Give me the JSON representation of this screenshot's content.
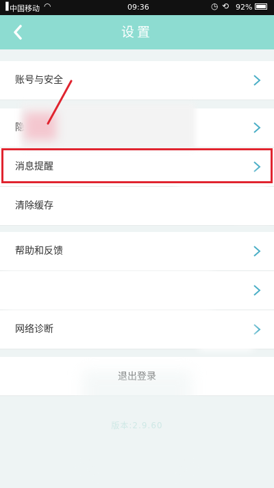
{
  "status_bar": {
    "carrier": "中国移动",
    "time": "09:36",
    "battery": "92%"
  },
  "nav": {
    "title": "设置",
    "back_icon": "chevron-left-icon"
  },
  "settings": {
    "items": [
      {
        "label": "账号与安全"
      },
      {
        "label": "隐"
      },
      {
        "label": "消息提醒"
      },
      {
        "label": "清除缓存"
      },
      {
        "label": "帮助和反馈"
      },
      {
        "label": ""
      },
      {
        "label": "网络诊断"
      }
    ]
  },
  "logout": {
    "label": "退出登录"
  },
  "version": {
    "label": "版本:2.9.60"
  },
  "colors": {
    "accent": "#8ddcd1",
    "highlight": "#e0242f",
    "chevron": "#4aaec6"
  }
}
